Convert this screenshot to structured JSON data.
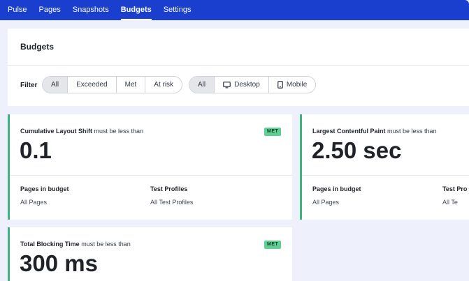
{
  "nav": {
    "brand": "Pulse",
    "items": [
      "Pages",
      "Snapshots",
      "Budgets",
      "Settings"
    ],
    "active": "Budgets"
  },
  "page": {
    "title": "Budgets"
  },
  "filter": {
    "label": "Filter",
    "status_options": [
      "All",
      "Exceeded",
      "Met",
      "At risk"
    ],
    "status_selected": "All",
    "device_options": [
      "All",
      "Desktop",
      "Mobile"
    ],
    "device_selected": "All"
  },
  "cards": [
    {
      "metric": "Cumulative Layout Shift",
      "condition": "must be less than",
      "value": "0.1",
      "badge": "MET",
      "pages_title": "Pages in budget",
      "pages_value": "All Pages",
      "profiles_title": "Test Profiles",
      "profiles_value": "All Test Profiles"
    },
    {
      "metric": "Largest Contentful Paint",
      "condition": "must be less than",
      "value": "2.50 sec",
      "badge": "",
      "pages_title": "Pages in budget",
      "pages_value": "All Pages",
      "profiles_title": "Test Pro",
      "profiles_value": "All Te"
    },
    {
      "metric": "Total Blocking Time",
      "condition": "must be less than",
      "value": "300 ms",
      "badge": "MET"
    }
  ],
  "colors": {
    "nav_bg": "#1a3fcf",
    "accent_met": "#3fb27f",
    "badge_bg": "#5fcf95",
    "page_bg": "#eef1fb"
  },
  "icons": {
    "desktop": "desktop-icon",
    "mobile": "mobile-icon"
  }
}
